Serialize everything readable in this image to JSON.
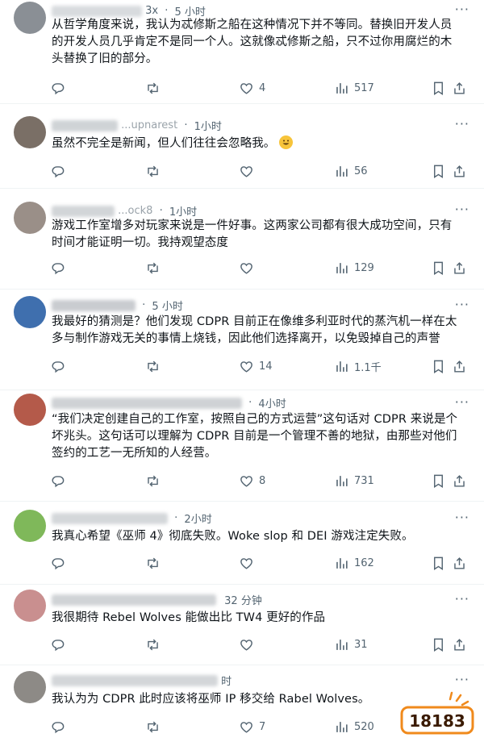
{
  "posts": [
    {
      "name_fragment": "3x",
      "time": "5 小时",
      "lines": [
        "从哲学角度来说，我认为忒修斯之船在这种情况下并不等同。替换旧开发人员",
        "的开发人员几乎肯定不是同一个人。这就像忒修斯之船，只不过你用腐烂的木",
        "头替换了旧的部分。"
      ],
      "likes": "4",
      "views": "517",
      "avatar_color": "#8a8f95"
    },
    {
      "name_fragment": "...upnarest",
      "time": "1小时",
      "lines": [
        "虽然不完全是新闻，但人们往往会忽略我。"
      ],
      "emoji": "grinning-face",
      "likes": "",
      "views": "56",
      "avatar_color": "#7a6f66"
    },
    {
      "name_fragment": "...ock8",
      "time": "1小时",
      "lines": [
        "游戏工作室增多对玩家来说是一件好事。这两家公司都有很大成功空间，只有",
        "时间才能证明一切。我持观望态度"
      ],
      "likes": "",
      "views": "129",
      "avatar_color": "#9a8f88"
    },
    {
      "name_fragment": "",
      "time": "5 小时",
      "lines": [
        "我最好的猜测是？他们发现 CDPR 目前正在像维多利亚时代的蒸汽机一样在太",
        "多与制作游戏无关的事情上烧钱，因此他们选择离开，以免毁掉自己的声誉"
      ],
      "likes": "14",
      "views": "1.1千",
      "avatar_color": "#3f6fae"
    },
    {
      "name_fragment": "",
      "time": "4小时",
      "lines": [
        "“我们决定创建自己的工作室，按照自己的方式运营”这句话对 CDPR 来说是个",
        "坏兆头。这句话可以理解为 CDPR 目前是一个管理不善的地狱，由那些对他们",
        "签约的工艺一无所知的人经营。"
      ],
      "likes": "8",
      "views": "731",
      "avatar_color": "#b45a4a"
    },
    {
      "name_fragment": "",
      "time": "2小时",
      "lines": [
        "我真心希望《巫师 4》彻底失败。Woke slop 和 DEI 游戏注定失败。"
      ],
      "likes": "",
      "views": "162",
      "avatar_color": "#7fb85a"
    },
    {
      "name_fragment": "",
      "time": "32 分钟",
      "lines": [
        "我很期待 Rebel Wolves 能做出比 TW4 更好的作品"
      ],
      "likes": "",
      "views": "31",
      "avatar_color": "#c98f8f"
    },
    {
      "name_fragment": "",
      "time": "时",
      "lines": [
        "我认为为 CDPR 此时应该将巫师 IP 移交给 Rabel Wolves。"
      ],
      "likes": "7",
      "views": "520",
      "avatar_color": "#8d8a86"
    }
  ],
  "watermark": {
    "text": "18183",
    "color": "#f08a1c",
    "text_color": "#3a1a00"
  },
  "icons": {
    "reply": "reply-icon",
    "repost": "repost-icon",
    "like": "like-icon",
    "views": "views-icon",
    "bookmark": "bookmark-icon",
    "share": "share-icon",
    "more": "more-icon"
  },
  "colors": {
    "text": "#0f1419",
    "muted": "#536471",
    "divider": "#eff3f4"
  }
}
